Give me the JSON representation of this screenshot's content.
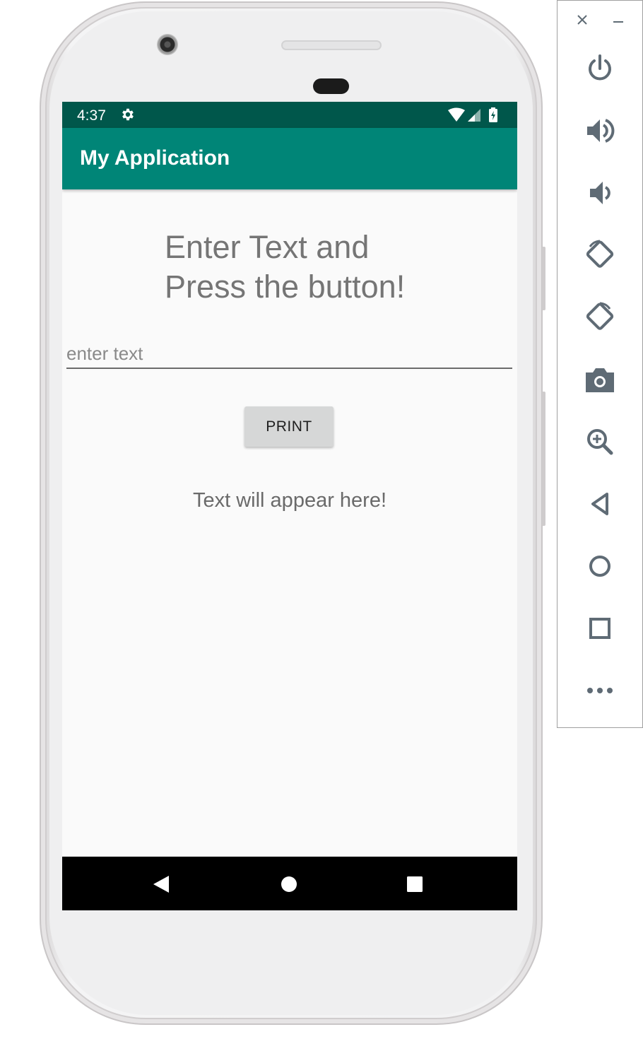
{
  "status_bar": {
    "time": "4:37",
    "icons": [
      "settings-icon",
      "wifi-icon",
      "cell-signal-icon",
      "battery-charging-icon"
    ]
  },
  "app_bar": {
    "title": "My Application"
  },
  "main": {
    "heading": "Enter Text and\nPress the button!",
    "input": {
      "value": "",
      "placeholder": "enter text"
    },
    "print_button_label": "PRINT",
    "output_text": "Text will appear here!"
  },
  "nav_bar": {
    "buttons": [
      "back-icon",
      "home-icon",
      "recents-icon"
    ]
  },
  "emulator_toolbar": {
    "window_controls": [
      "close-icon",
      "minimize-icon"
    ],
    "buttons": [
      "power-icon",
      "volume-up-icon",
      "volume-down-icon",
      "rotate-left-icon",
      "rotate-right-icon",
      "screenshot-icon",
      "zoom-icon",
      "back-icon",
      "home-icon",
      "overview-icon",
      "more-icon"
    ]
  },
  "colors": {
    "status_bar": "#00574b",
    "app_bar": "#008577",
    "screen_background": "#fafafa",
    "button_background": "#d6d7d7",
    "toolbar_icon": "#5f6b75"
  }
}
